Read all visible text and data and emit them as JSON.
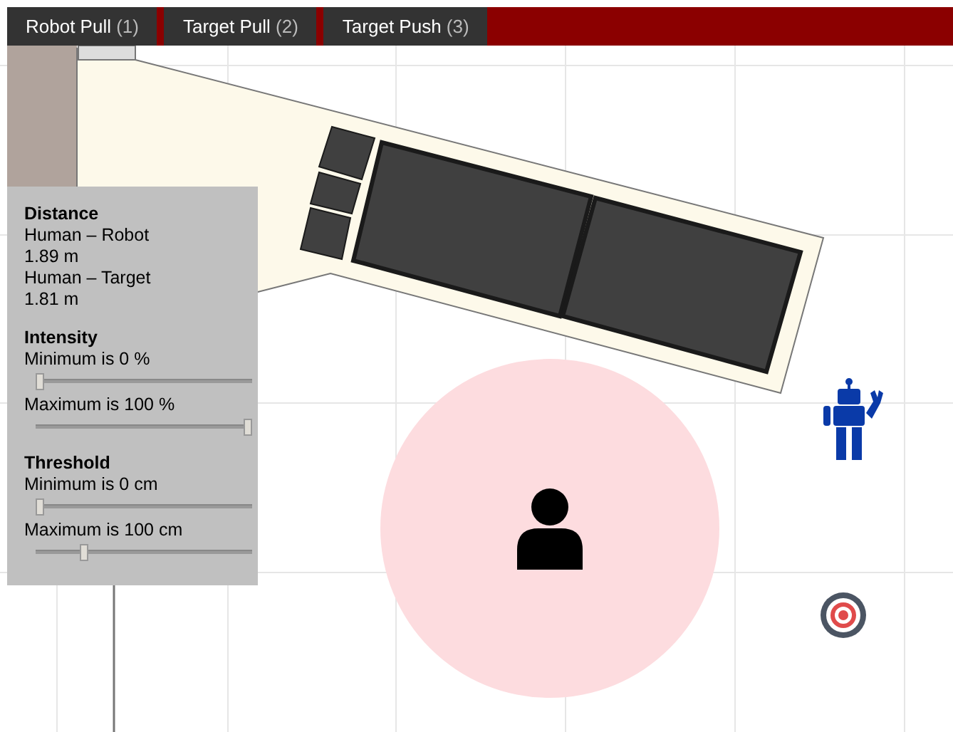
{
  "tabs": [
    {
      "label": "Robot Pull",
      "shortcut": "(1)"
    },
    {
      "label": "Target Pull",
      "shortcut": "(2)"
    },
    {
      "label": "Target Push",
      "shortcut": "(3)"
    }
  ],
  "panel": {
    "distance": {
      "title": "Distance",
      "lines": [
        "Human – Robot",
        "1.89 m",
        "Human – Target",
        "1.81 m"
      ]
    },
    "sections": [
      {
        "title": "Intensity",
        "sliders": [
          {
            "label": "Minimum is 0 %",
            "level": 0
          },
          {
            "label": "Maximum is 100 %",
            "level": 1
          }
        ]
      },
      {
        "title": "Threshold",
        "sliders": [
          {
            "label": "Minimum is 0 cm",
            "level": 0
          },
          {
            "label": "Maximum is 100 cm",
            "level": 0.21
          }
        ]
      }
    ]
  }
}
